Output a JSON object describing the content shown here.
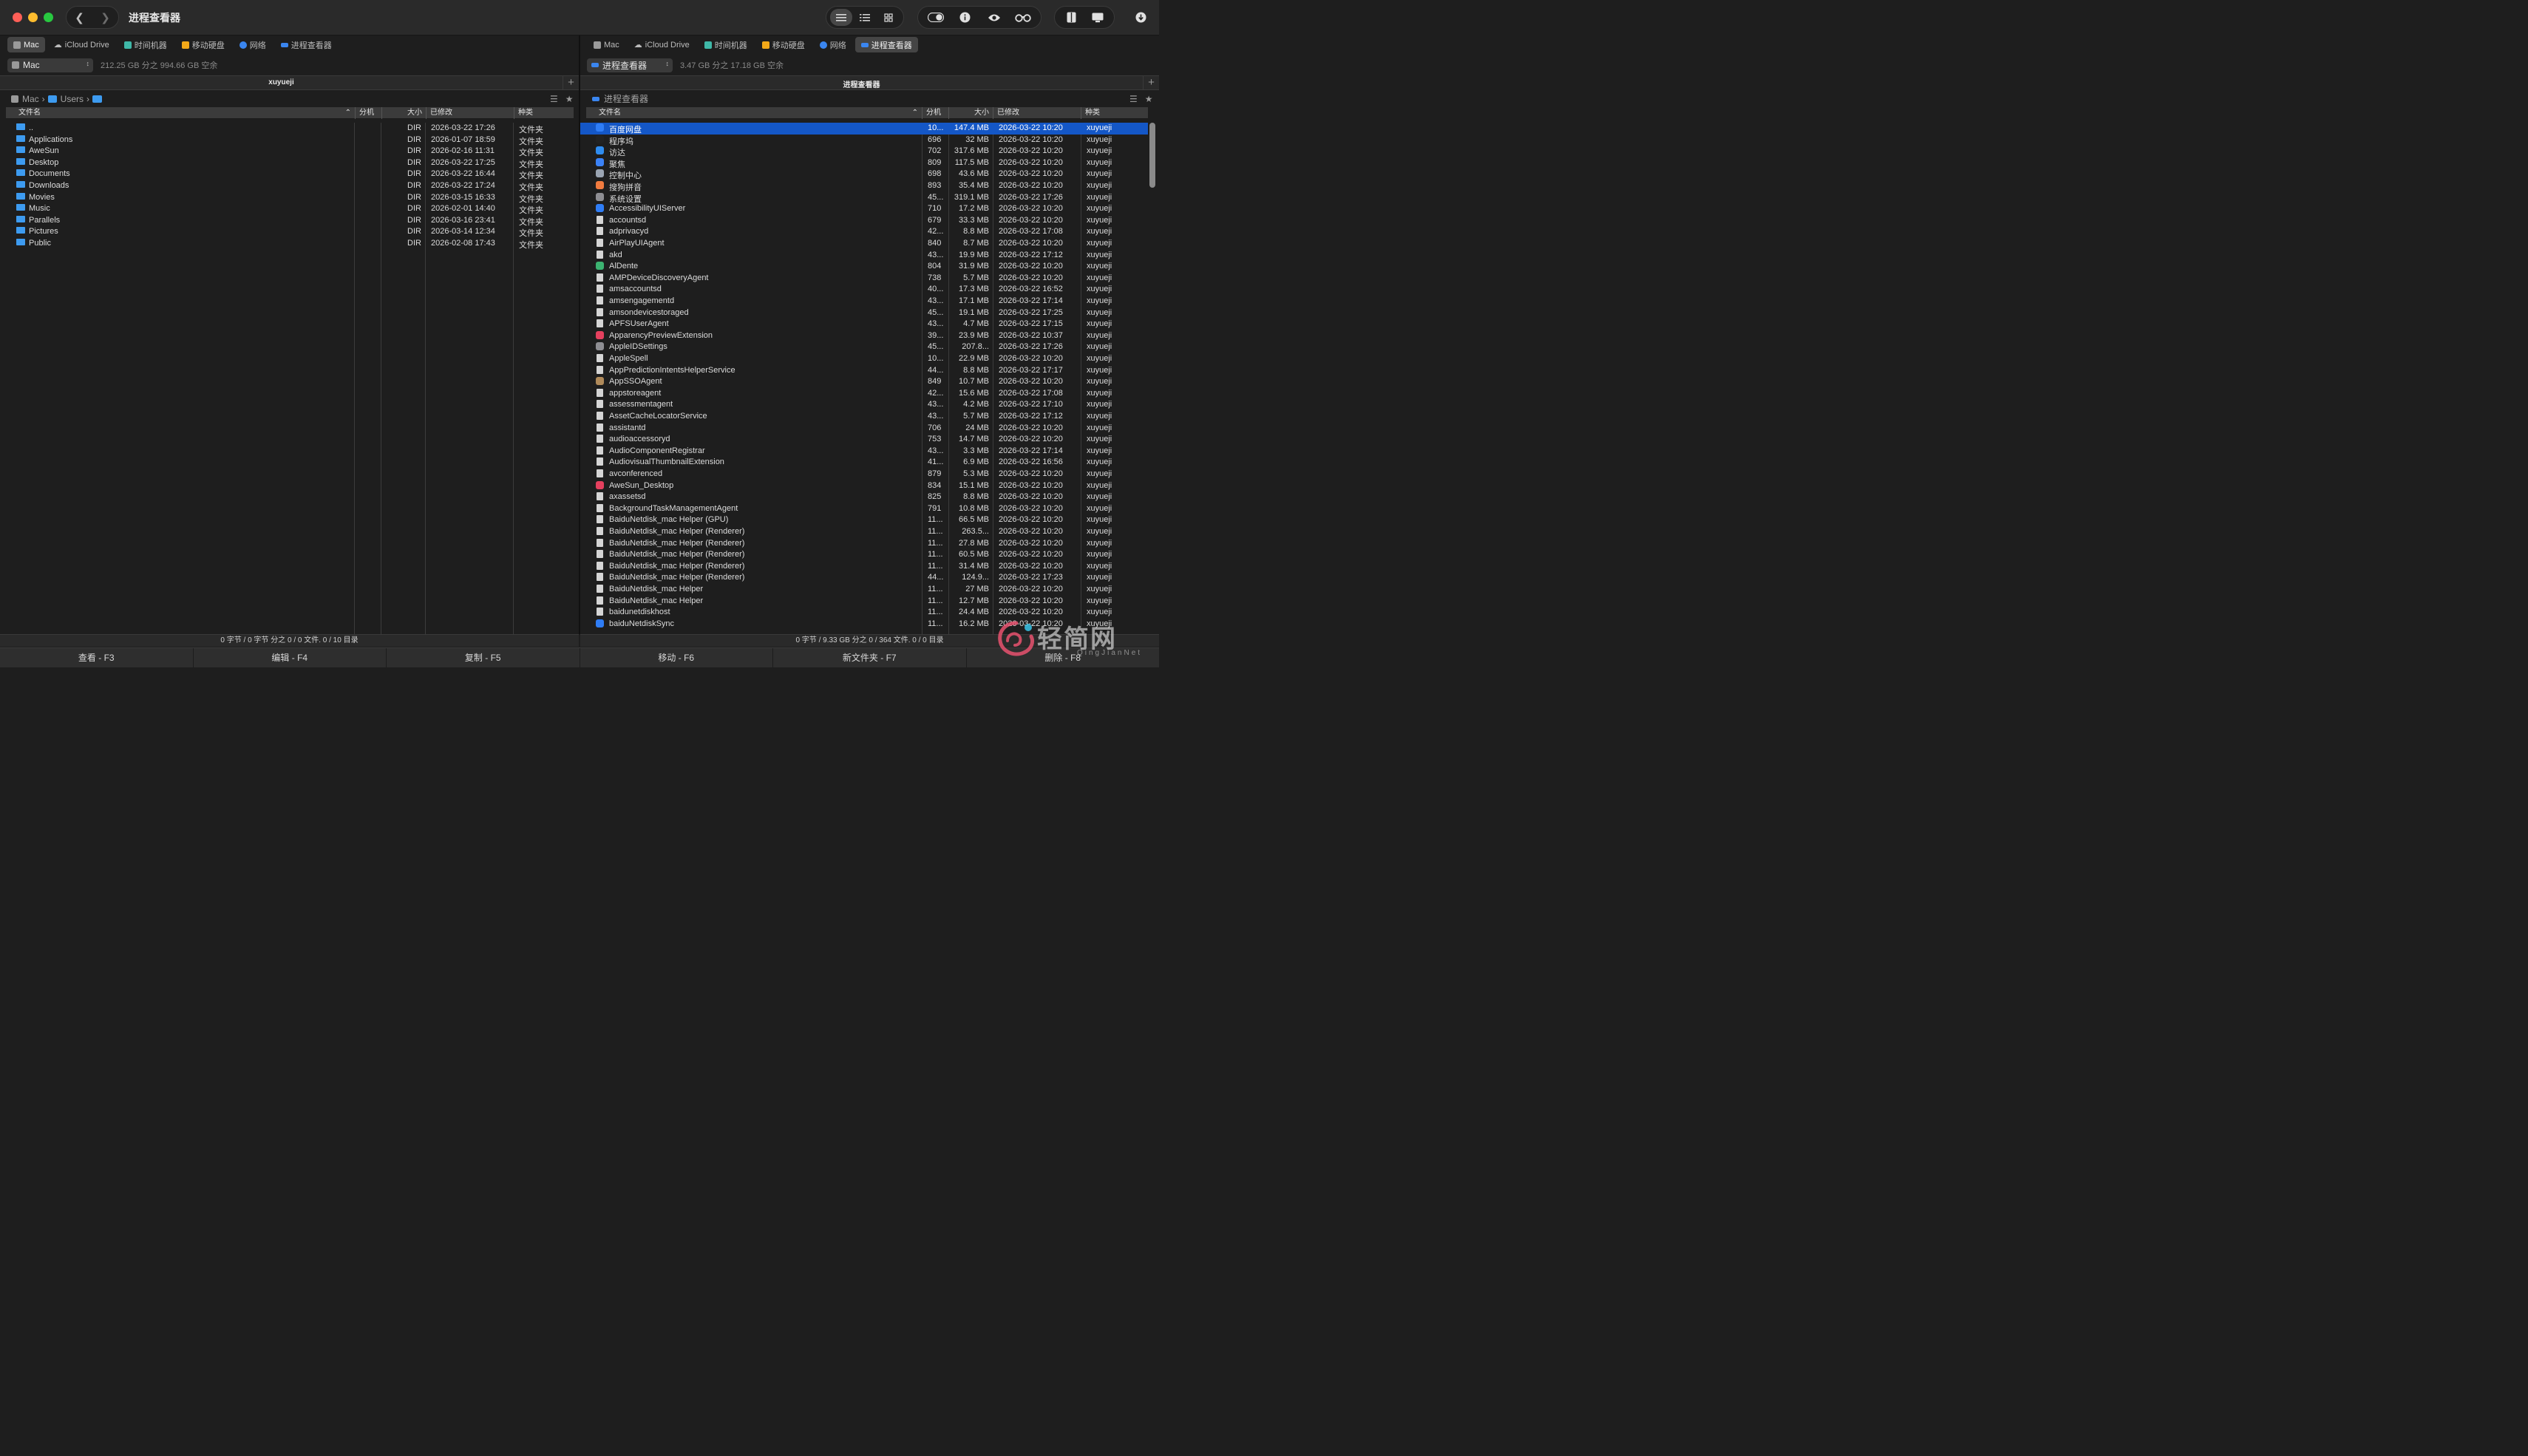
{
  "window": {
    "title": "进程查看器"
  },
  "left": {
    "tabs": [
      {
        "label": "Mac",
        "icon": "mac-icon",
        "active": true
      },
      {
        "label": "iCloud Drive",
        "icon": "cloud-icon",
        "active": false
      },
      {
        "label": "时间机器",
        "icon": "timemachine-icon",
        "active": false
      },
      {
        "label": "移动硬盘",
        "icon": "drive-icon",
        "active": false
      },
      {
        "label": "网络",
        "icon": "globe-icon",
        "active": false
      },
      {
        "label": "进程查看器",
        "icon": "process-icon",
        "active": false
      }
    ],
    "volume": "Mac",
    "volume_info": "212.25 GB 分之 994.66 GB 空余",
    "pane_title": "xuyueji",
    "path": [
      "Mac",
      "Users"
    ],
    "columns": {
      "name": "文件名",
      "ext": "分机",
      "size": "大小",
      "modified": "已修改",
      "kind": "种类"
    },
    "rows": [
      {
        "name": "..",
        "size": "DIR",
        "modified": "2026-03-22 17:26",
        "kind": "文件夹"
      },
      {
        "name": "Applications",
        "size": "DIR",
        "modified": "2026-01-07 18:59",
        "kind": "文件夹"
      },
      {
        "name": "AweSun",
        "size": "DIR",
        "modified": "2026-02-16 11:31",
        "kind": "文件夹"
      },
      {
        "name": "Desktop",
        "size": "DIR",
        "modified": "2026-03-22 17:25",
        "kind": "文件夹"
      },
      {
        "name": "Documents",
        "size": "DIR",
        "modified": "2026-03-22 16:44",
        "kind": "文件夹"
      },
      {
        "name": "Downloads",
        "size": "DIR",
        "modified": "2026-03-22 17:24",
        "kind": "文件夹"
      },
      {
        "name": "Movies",
        "size": "DIR",
        "modified": "2026-03-15 16:33",
        "kind": "文件夹"
      },
      {
        "name": "Music",
        "size": "DIR",
        "modified": "2026-02-01 14:40",
        "kind": "文件夹"
      },
      {
        "name": "Parallels",
        "size": "DIR",
        "modified": "2026-03-16 23:41",
        "kind": "文件夹"
      },
      {
        "name": "Pictures",
        "size": "DIR",
        "modified": "2026-03-14 12:34",
        "kind": "文件夹"
      },
      {
        "name": "Public",
        "size": "DIR",
        "modified": "2026-02-08 17:43",
        "kind": "文件夹"
      }
    ],
    "status": "0 字节 / 0 字节 分之 0 / 0 文件. 0 / 10 目录"
  },
  "right": {
    "tabs": [
      {
        "label": "Mac",
        "icon": "mac-icon",
        "active": false
      },
      {
        "label": "iCloud Drive",
        "icon": "cloud-icon",
        "active": false
      },
      {
        "label": "时间机器",
        "icon": "timemachine-icon",
        "active": false
      },
      {
        "label": "移动硬盘",
        "icon": "drive-icon",
        "active": false
      },
      {
        "label": "网络",
        "icon": "globe-icon",
        "active": false
      },
      {
        "label": "进程查看器",
        "icon": "process-icon",
        "active": true
      }
    ],
    "volume": "进程查看器",
    "volume_info": "3.47 GB 分之 17.18 GB 空余",
    "pane_title": "进程查看器",
    "path": [
      "进程查看器"
    ],
    "columns": {
      "name": "文件名",
      "ext": "分机",
      "size": "大小",
      "modified": "已修改",
      "kind": "种类"
    },
    "rows": [
      {
        "name": "百度网盘",
        "pid": "10...",
        "size": "147.4 MB",
        "modified": "2026-03-22 10:20",
        "kind": "xuyueji",
        "color": "#2f7df6"
      },
      {
        "name": "程序坞",
        "pid": "696",
        "size": "32 MB",
        "modified": "2026-03-22 10:20",
        "kind": "xuyueji",
        "color": "#222222"
      },
      {
        "name": "访达",
        "pid": "702",
        "size": "317.6 MB",
        "modified": "2026-03-22 10:20",
        "kind": "xuyueji",
        "color": "#2f8cf0"
      },
      {
        "name": "聚焦",
        "pid": "809",
        "size": "117.5 MB",
        "modified": "2026-03-22 10:20",
        "kind": "xuyueji",
        "color": "#3b82f6"
      },
      {
        "name": "控制中心",
        "pid": "698",
        "size": "43.6 MB",
        "modified": "2026-03-22 10:20",
        "kind": "xuyueji",
        "color": "#9aa4b2"
      },
      {
        "name": "搜狗拼音",
        "pid": "893",
        "size": "35.4 MB",
        "modified": "2026-03-22 10:20",
        "kind": "xuyueji",
        "color": "#f07b3f"
      },
      {
        "name": "系统设置",
        "pid": "45...",
        "size": "319.1 MB",
        "modified": "2026-03-22 17:26",
        "kind": "xuyueji",
        "color": "#8e8e93"
      },
      {
        "name": "AccessibilityUIServer",
        "pid": "710",
        "size": "17.2 MB",
        "modified": "2026-03-22 10:20",
        "kind": "xuyueji",
        "color": "#2f7df6"
      },
      {
        "name": "accountsd",
        "pid": "679",
        "size": "33.3 MB",
        "modified": "2026-03-22 10:20",
        "kind": "xuyueji",
        "color": ""
      },
      {
        "name": "adprivacyd",
        "pid": "42...",
        "size": "8.8 MB",
        "modified": "2026-03-22 17:08",
        "kind": "xuyueji",
        "color": ""
      },
      {
        "name": "AirPlayUIAgent",
        "pid": "840",
        "size": "8.7 MB",
        "modified": "2026-03-22 10:20",
        "kind": "xuyueji",
        "color": ""
      },
      {
        "name": "akd",
        "pid": "43...",
        "size": "19.9 MB",
        "modified": "2026-03-22 17:12",
        "kind": "xuyueji",
        "color": ""
      },
      {
        "name": "AlDente",
        "pid": "804",
        "size": "31.9 MB",
        "modified": "2026-03-22 10:20",
        "kind": "xuyueji",
        "color": "#3cb371"
      },
      {
        "name": "AMPDeviceDiscoveryAgent",
        "pid": "738",
        "size": "5.7 MB",
        "modified": "2026-03-22 10:20",
        "kind": "xuyueji",
        "color": ""
      },
      {
        "name": "amsaccountsd",
        "pid": "40...",
        "size": "17.3 MB",
        "modified": "2026-03-22 16:52",
        "kind": "xuyueji",
        "color": ""
      },
      {
        "name": "amsengagementd",
        "pid": "43...",
        "size": "17.1 MB",
        "modified": "2026-03-22 17:14",
        "kind": "xuyueji",
        "color": ""
      },
      {
        "name": "amsondevicestoraged",
        "pid": "45...",
        "size": "19.1 MB",
        "modified": "2026-03-22 17:25",
        "kind": "xuyueji",
        "color": ""
      },
      {
        "name": "APFSUserAgent",
        "pid": "43...",
        "size": "4.7 MB",
        "modified": "2026-03-22 17:15",
        "kind": "xuyueji",
        "color": ""
      },
      {
        "name": "ApparencyPreviewExtension",
        "pid": "39...",
        "size": "23.9 MB",
        "modified": "2026-03-22 10:37",
        "kind": "xuyueji",
        "color": "#e5405e"
      },
      {
        "name": "AppleIDSettings",
        "pid": "45...",
        "size": "207.8...",
        "modified": "2026-03-22 17:26",
        "kind": "xuyueji",
        "color": "#8e8e93"
      },
      {
        "name": "AppleSpell",
        "pid": "10...",
        "size": "22.9 MB",
        "modified": "2026-03-22 10:20",
        "kind": "xuyueji",
        "color": ""
      },
      {
        "name": "AppPredictionIntentsHelperService",
        "pid": "44...",
        "size": "8.8 MB",
        "modified": "2026-03-22 17:17",
        "kind": "xuyueji",
        "color": ""
      },
      {
        "name": "AppSSOAgent",
        "pid": "849",
        "size": "10.7 MB",
        "modified": "2026-03-22 10:20",
        "kind": "xuyueji",
        "color": "#b08a5a"
      },
      {
        "name": "appstoreagent",
        "pid": "42...",
        "size": "15.6 MB",
        "modified": "2026-03-22 17:08",
        "kind": "xuyueji",
        "color": ""
      },
      {
        "name": "assessmentagent",
        "pid": "43...",
        "size": "4.2 MB",
        "modified": "2026-03-22 17:10",
        "kind": "xuyueji",
        "color": ""
      },
      {
        "name": "AssetCacheLocatorService",
        "pid": "43...",
        "size": "5.7 MB",
        "modified": "2026-03-22 17:12",
        "kind": "xuyueji",
        "color": ""
      },
      {
        "name": "assistantd",
        "pid": "706",
        "size": "24 MB",
        "modified": "2026-03-22 10:20",
        "kind": "xuyueji",
        "color": ""
      },
      {
        "name": "audioaccessoryd",
        "pid": "753",
        "size": "14.7 MB",
        "modified": "2026-03-22 10:20",
        "kind": "xuyueji",
        "color": ""
      },
      {
        "name": "AudioComponentRegistrar",
        "pid": "43...",
        "size": "3.3 MB",
        "modified": "2026-03-22 17:14",
        "kind": "xuyueji",
        "color": ""
      },
      {
        "name": "AudiovisualThumbnailExtension",
        "pid": "41...",
        "size": "6.9 MB",
        "modified": "2026-03-22 16:56",
        "kind": "xuyueji",
        "color": ""
      },
      {
        "name": "avconferenced",
        "pid": "879",
        "size": "5.3 MB",
        "modified": "2026-03-22 10:20",
        "kind": "xuyueji",
        "color": ""
      },
      {
        "name": "AweSun_Desktop",
        "pid": "834",
        "size": "15.1 MB",
        "modified": "2026-03-22 10:20",
        "kind": "xuyueji",
        "color": "#e5405e"
      },
      {
        "name": "axassetsd",
        "pid": "825",
        "size": "8.8 MB",
        "modified": "2026-03-22 10:20",
        "kind": "xuyueji",
        "color": ""
      },
      {
        "name": "BackgroundTaskManagementAgent",
        "pid": "791",
        "size": "10.8 MB",
        "modified": "2026-03-22 10:20",
        "kind": "xuyueji",
        "color": ""
      },
      {
        "name": "BaiduNetdisk_mac Helper (GPU)",
        "pid": "11...",
        "size": "66.5 MB",
        "modified": "2026-03-22 10:20",
        "kind": "xuyueji",
        "color": ""
      },
      {
        "name": "BaiduNetdisk_mac Helper (Renderer)",
        "pid": "11...",
        "size": "263.5...",
        "modified": "2026-03-22 10:20",
        "kind": "xuyueji",
        "color": ""
      },
      {
        "name": "BaiduNetdisk_mac Helper (Renderer)",
        "pid": "11...",
        "size": "27.8 MB",
        "modified": "2026-03-22 10:20",
        "kind": "xuyueji",
        "color": ""
      },
      {
        "name": "BaiduNetdisk_mac Helper (Renderer)",
        "pid": "11...",
        "size": "60.5 MB",
        "modified": "2026-03-22 10:20",
        "kind": "xuyueji",
        "color": ""
      },
      {
        "name": "BaiduNetdisk_mac Helper (Renderer)",
        "pid": "11...",
        "size": "31.4 MB",
        "modified": "2026-03-22 10:20",
        "kind": "xuyueji",
        "color": ""
      },
      {
        "name": "BaiduNetdisk_mac Helper (Renderer)",
        "pid": "44...",
        "size": "124.9...",
        "modified": "2026-03-22 17:23",
        "kind": "xuyueji",
        "color": ""
      },
      {
        "name": "BaiduNetdisk_mac Helper",
        "pid": "11...",
        "size": "27 MB",
        "modified": "2026-03-22 10:20",
        "kind": "xuyueji",
        "color": ""
      },
      {
        "name": "BaiduNetdisk_mac Helper",
        "pid": "11...",
        "size": "12.7 MB",
        "modified": "2026-03-22 10:20",
        "kind": "xuyueji",
        "color": ""
      },
      {
        "name": "baidunetdiskhost",
        "pid": "11...",
        "size": "24.4 MB",
        "modified": "2026-03-22 10:20",
        "kind": "xuyueji",
        "color": ""
      },
      {
        "name": "baiduNetdiskSync",
        "pid": "11...",
        "size": "16.2 MB",
        "modified": "2026-03-22 10:20",
        "kind": "xuyueji",
        "color": "#2f7df6"
      }
    ],
    "status": "0 字节 / 9.33 GB 分之 0 / 364 文件. 0 / 0 目录"
  },
  "fkeys": [
    "查看 - F3",
    "编辑 - F4",
    "复制 - F5",
    "移动 - F6",
    "新文件夹 - F7",
    "删除 - F8"
  ],
  "watermark": {
    "text": "轻简网",
    "subtext": "QingJianNet"
  }
}
